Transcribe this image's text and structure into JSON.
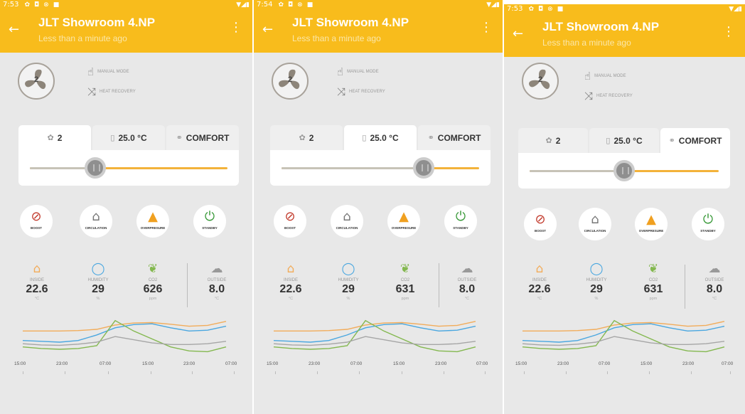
{
  "colors": {
    "appbar": "#f8bc1c",
    "background": "#e8e8e8",
    "inside": "#f2ac5a",
    "humidity": "#4aa7e0",
    "co2": "#84b850",
    "outside": "#a6a6a6"
  },
  "app": {
    "title": "JLT Showroom 4.NP",
    "subtitle": "Less than a minute ago",
    "back_icon": "←",
    "more_icon": "⋮"
  },
  "screens": [
    {
      "status": {
        "time": "7:53",
        "icons": [
          "✿",
          "◘",
          "⊗",
          "■"
        ],
        "signal": "▼◢▮"
      },
      "fan": {
        "speed": "2"
      },
      "modes": [
        {
          "icon": "☝",
          "label": "MANUAL MODE"
        },
        {
          "icon": "⤨",
          "label": "HEAT RECOVERY"
        }
      ],
      "tabs": [
        {
          "icon": "✿",
          "label": "2",
          "active": true
        },
        {
          "icon": "▯",
          "label": "25.0 °C",
          "active": false
        },
        {
          "icon": "⚭",
          "label": "COMFORT",
          "active": false
        }
      ],
      "slider_value": 0.33,
      "buttons": [
        {
          "icon": "⊘",
          "label": "BOOST"
        },
        {
          "icon": "⌂",
          "label": "CIRCULATION"
        },
        {
          "icon": "▲",
          "label": "OVERPRESURE"
        },
        {
          "icon": "⏻",
          "label": "STANDBY"
        }
      ],
      "sensors": [
        {
          "icon": "⌂",
          "name": "INSIDE",
          "value": "22.6",
          "unit": "°C"
        },
        {
          "icon": "◯",
          "name": "HUMIDITY",
          "value": "29",
          "unit": "%"
        },
        {
          "icon": "❦",
          "name": "CO2",
          "value": "626",
          "unit": "ppm"
        },
        {
          "icon": "☁",
          "name": "OUTSIDE",
          "value": "8.0",
          "unit": "°C"
        }
      ],
      "x_labels": [
        "15:00",
        "23:00",
        "07:00",
        "15:00",
        "23:00",
        "07:00"
      ]
    },
    {
      "status": {
        "time": "7:54",
        "icons": [
          "✿",
          "◘",
          "⊗",
          "■"
        ],
        "signal": "▼◢▮"
      },
      "fan": {
        "speed": "2"
      },
      "modes": [
        {
          "icon": "☝",
          "label": "MANUAL MODE"
        },
        {
          "icon": "⤨",
          "label": "HEAT RECOVERY"
        }
      ],
      "tabs": [
        {
          "icon": "✿",
          "label": "2",
          "active": false
        },
        {
          "icon": "▯",
          "label": "25.0 °C",
          "active": true
        },
        {
          "icon": "⚭",
          "label": "COMFORT",
          "active": false
        }
      ],
      "slider_value": 0.72,
      "buttons": [
        {
          "icon": "⊘",
          "label": "BOOST"
        },
        {
          "icon": "⌂",
          "label": "CIRCULATION"
        },
        {
          "icon": "▲",
          "label": "OVERPRESURE"
        },
        {
          "icon": "⏻",
          "label": "STANDBY"
        }
      ],
      "sensors": [
        {
          "icon": "⌂",
          "name": "INSIDE",
          "value": "22.6",
          "unit": "°C"
        },
        {
          "icon": "◯",
          "name": "HUMIDITY",
          "value": "29",
          "unit": "%"
        },
        {
          "icon": "❦",
          "name": "CO2",
          "value": "631",
          "unit": "ppm"
        },
        {
          "icon": "☁",
          "name": "OUTSIDE",
          "value": "8.0",
          "unit": "°C"
        }
      ],
      "x_labels": [
        "15:00",
        "23:00",
        "07:00",
        "15:00",
        "23:00",
        "07:00"
      ]
    },
    {
      "status": {
        "time": "7:53",
        "icons": [
          "✿",
          "◘",
          "⊗",
          "■"
        ],
        "signal": "▼◢▮"
      },
      "fan": {
        "speed": "2"
      },
      "modes": [
        {
          "icon": "☝",
          "label": "MANUAL MODE"
        },
        {
          "icon": "⤨",
          "label": "HEAT RECOVERY"
        }
      ],
      "tabs": [
        {
          "icon": "✿",
          "label": "2",
          "active": false
        },
        {
          "icon": "▯",
          "label": "25.0 °C",
          "active": false
        },
        {
          "icon": "⚭",
          "label": "COMFORT",
          "active": true
        }
      ],
      "slider_value": 0.5,
      "buttons": [
        {
          "icon": "⊘",
          "label": "BOOST"
        },
        {
          "icon": "⌂",
          "label": "CIRCULATION"
        },
        {
          "icon": "▲",
          "label": "OVERPRESURE"
        },
        {
          "icon": "⏻",
          "label": "STANDBY"
        }
      ],
      "sensors": [
        {
          "icon": "⌂",
          "name": "INSIDE",
          "value": "22.6",
          "unit": "°C"
        },
        {
          "icon": "◯",
          "name": "HUMIDITY",
          "value": "29",
          "unit": "%"
        },
        {
          "icon": "❦",
          "name": "CO2",
          "value": "631",
          "unit": "ppm"
        },
        {
          "icon": "☁",
          "name": "OUTSIDE",
          "value": "8.0",
          "unit": "°C"
        }
      ],
      "x_labels": [
        "15:00",
        "23:00",
        "07:00",
        "15:00",
        "23:00",
        "07:00"
      ]
    }
  ],
  "chart_data": {
    "type": "line",
    "x": [
      "15:00",
      "23:00",
      "07:00",
      "15:00",
      "23:00",
      "07:00"
    ],
    "grid": false,
    "series": [
      {
        "color": "#f2ac5a",
        "values": [
          0.62,
          0.62,
          0.62,
          0.63,
          0.66,
          0.77,
          0.82,
          0.83,
          0.79,
          0.74,
          0.76,
          0.86
        ]
      },
      {
        "color": "#4aa7e0",
        "values": [
          0.38,
          0.36,
          0.34,
          0.38,
          0.52,
          0.7,
          0.78,
          0.8,
          0.7,
          0.62,
          0.64,
          0.74
        ]
      },
      {
        "color": "#84b850",
        "values": [
          0.22,
          0.18,
          0.16,
          0.18,
          0.25,
          0.88,
          0.62,
          0.42,
          0.22,
          0.12,
          0.1,
          0.22
        ]
      },
      {
        "color": "#a6a6a6",
        "values": [
          0.3,
          0.27,
          0.26,
          0.29,
          0.34,
          0.48,
          0.4,
          0.32,
          0.28,
          0.28,
          0.3,
          0.36
        ]
      }
    ]
  }
}
